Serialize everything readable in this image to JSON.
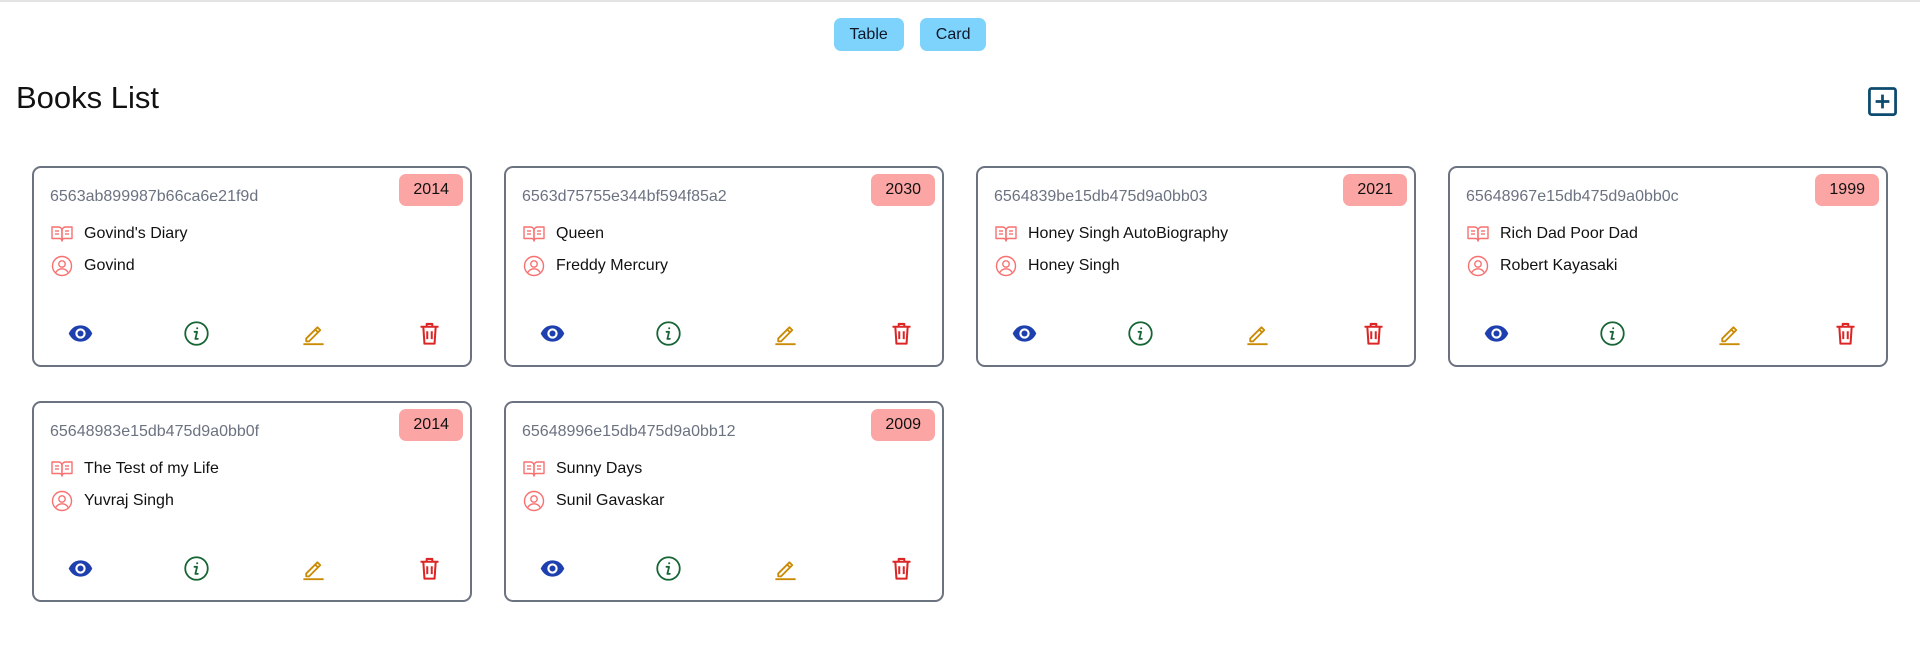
{
  "view_toggle": {
    "table_label": "Table",
    "card_label": "Card"
  },
  "page": {
    "title": "Books List"
  },
  "icons": {
    "add": "plus-square-icon",
    "title": "open-book-icon",
    "author": "user-circle-icon",
    "view": "eye-icon",
    "info": "info-circle-icon",
    "edit": "pencil-icon",
    "delete": "trash-icon"
  },
  "colors": {
    "toggle_button": "#7dd3fc",
    "year_badge": "#fca5a5",
    "view_icon": "#1e40af",
    "info_icon": "#166534",
    "edit_icon": "#ca8a04",
    "delete_icon": "#dc2626",
    "add_icon": "#0c4a6e"
  },
  "books": [
    {
      "id": "6563ab899987b66ca6e21f9d",
      "year": "2014",
      "title": "Govind's Diary",
      "author": "Govind"
    },
    {
      "id": "6563d75755e344bf594f85a2",
      "year": "2030",
      "title": "Queen",
      "author": "Freddy Mercury"
    },
    {
      "id": "6564839be15db475d9a0bb03",
      "year": "2021",
      "title": "Honey Singh AutoBiography",
      "author": "Honey Singh"
    },
    {
      "id": "65648967e15db475d9a0bb0c",
      "year": "1999",
      "title": "Rich Dad Poor Dad",
      "author": "Robert Kayasaki"
    },
    {
      "id": "65648983e15db475d9a0bb0f",
      "year": "2014",
      "title": "The Test of my Life",
      "author": "Yuvraj Singh"
    },
    {
      "id": "65648996e15db475d9a0bb12",
      "year": "2009",
      "title": "Sunny Days",
      "author": "Sunil Gavaskar"
    }
  ]
}
